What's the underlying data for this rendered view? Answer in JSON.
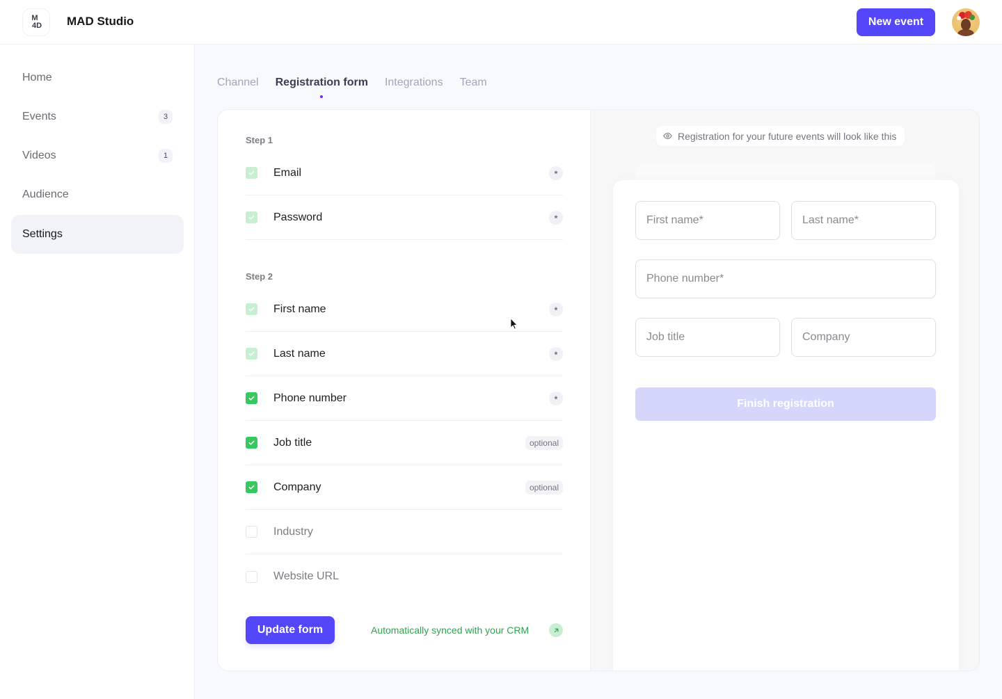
{
  "app": {
    "brand": "MAD Studio",
    "logo_lines": [
      "M",
      "4D"
    ],
    "new_event_label": "New event",
    "avatar_alt": "user-avatar"
  },
  "sidebar": {
    "items": [
      {
        "label": "Home",
        "badge": null,
        "active": false
      },
      {
        "label": "Events",
        "badge": "3",
        "active": false
      },
      {
        "label": "Videos",
        "badge": "1",
        "active": false
      },
      {
        "label": "Audience",
        "badge": null,
        "active": false
      },
      {
        "label": "Settings",
        "badge": null,
        "active": true
      }
    ]
  },
  "tabs": [
    {
      "label": "Channel",
      "active": false
    },
    {
      "label": "Registration form",
      "active": true
    },
    {
      "label": "Integrations",
      "active": false
    },
    {
      "label": "Team",
      "active": false
    }
  ],
  "form_builder": {
    "step1_label": "Step 1",
    "step2_label": "Step 2",
    "step1_fields": [
      {
        "label": "Email",
        "state": "locked",
        "tag": "*"
      },
      {
        "label": "Password",
        "state": "locked",
        "tag": "*"
      }
    ],
    "step2_fields": [
      {
        "label": "First name",
        "state": "locked",
        "tag": "*"
      },
      {
        "label": "Last name",
        "state": "locked",
        "tag": "*"
      },
      {
        "label": "Phone number",
        "state": "checked",
        "tag": "*"
      },
      {
        "label": "Job title",
        "state": "checked",
        "tag": "optional"
      },
      {
        "label": "Company",
        "state": "checked",
        "tag": "optional"
      },
      {
        "label": "Industry",
        "state": "unchecked",
        "tag": null
      },
      {
        "label": "Website URL",
        "state": "unchecked",
        "tag": null
      }
    ],
    "update_button": "Update form",
    "sync_text": "Automatically synced with your CRM"
  },
  "preview": {
    "note": "Registration for your future events will look like this",
    "fields": {
      "first_name": "First name*",
      "last_name": "Last name*",
      "phone": "Phone number*",
      "job_title": "Job title",
      "company": "Company"
    },
    "finish_button": "Finish registration"
  },
  "colors": {
    "accent": "#5447f9",
    "success": "#37c95e",
    "success_light": "#c8efd3",
    "tab_dot": "#6c2bf4",
    "finish_disabled": "#d5d6fb"
  }
}
